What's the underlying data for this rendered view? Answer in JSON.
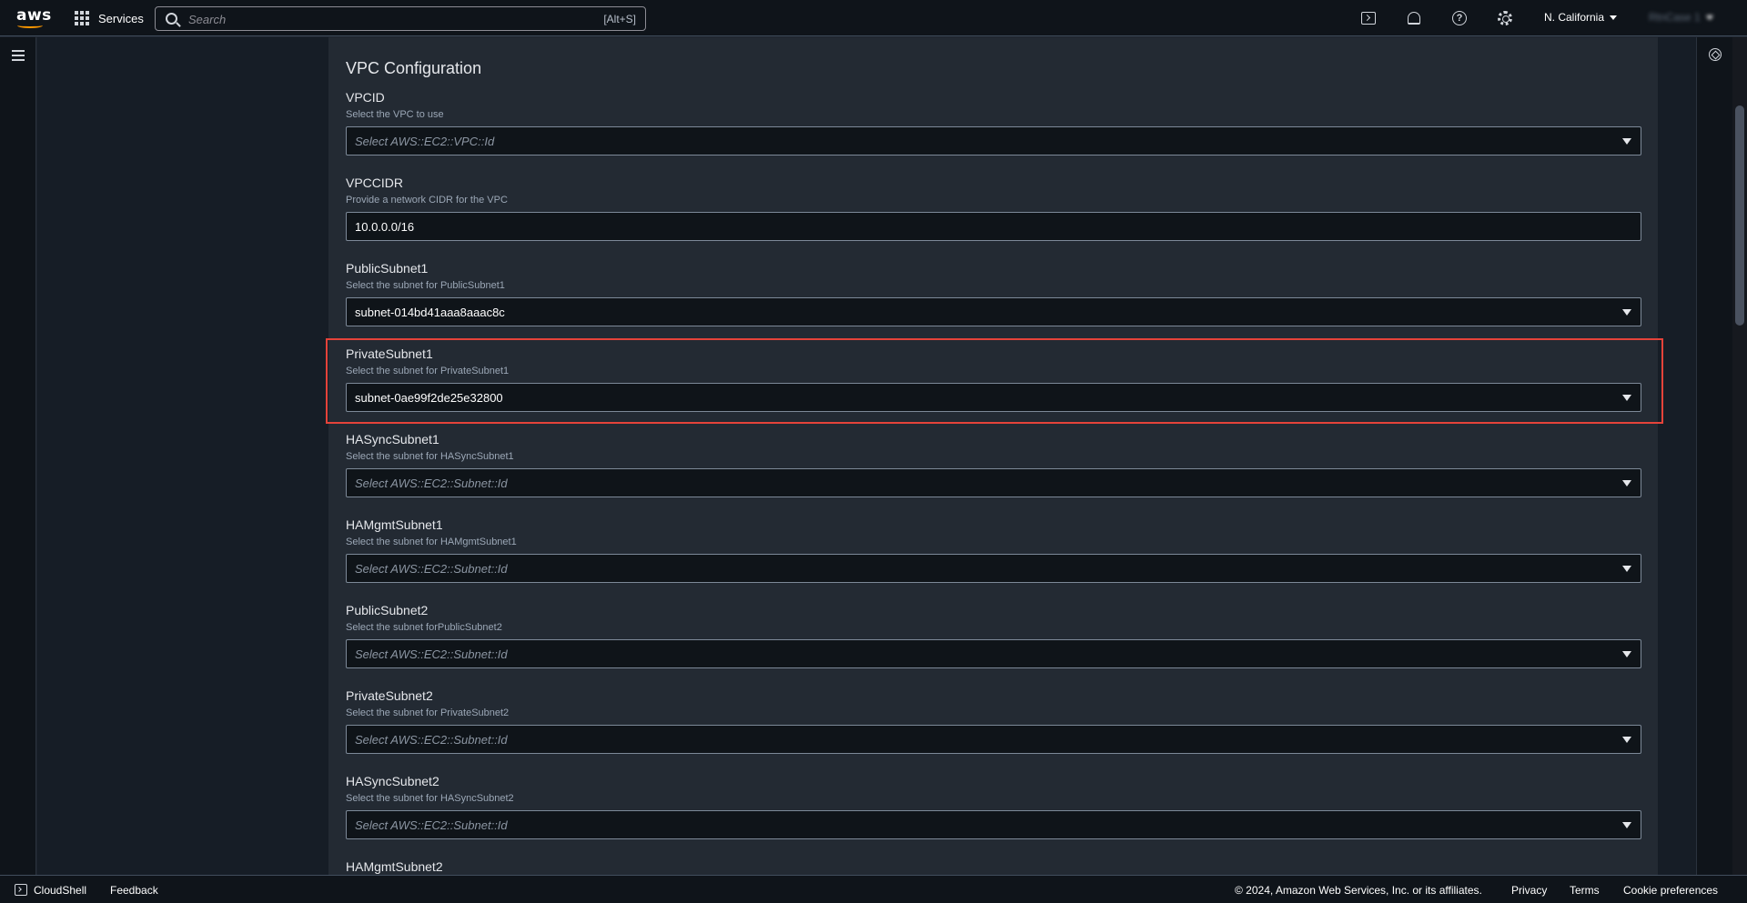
{
  "nav": {
    "logo": "aws",
    "services_label": "Services",
    "search_placeholder": "Search",
    "search_shortcut": "[Alt+S]",
    "region": "N. California",
    "account": "RtnCase 1"
  },
  "form": {
    "section_title": "VPC Configuration",
    "fields": [
      {
        "label": "VPCID",
        "description": "Select the VPC to use",
        "value": "Select AWS::EC2::VPC::Id",
        "type": "select",
        "is_placeholder": true
      },
      {
        "label": "VPCCIDR",
        "description": "Provide a network CIDR for the VPC",
        "value": "10.0.0.0/16",
        "type": "text",
        "is_placeholder": false
      },
      {
        "label": "PublicSubnet1",
        "description": "Select the subnet for PublicSubnet1",
        "value": "subnet-014bd41aaa8aaac8c",
        "type": "select",
        "is_placeholder": false
      },
      {
        "label": "PrivateSubnet1",
        "description": "Select the subnet for PrivateSubnet1",
        "value": "subnet-0ae99f2de25e32800",
        "type": "select",
        "is_placeholder": false
      },
      {
        "label": "HASyncSubnet1",
        "description": "Select the subnet for HASyncSubnet1",
        "value": "Select AWS::EC2::Subnet::Id",
        "type": "select",
        "is_placeholder": true
      },
      {
        "label": "HAMgmtSubnet1",
        "description": "Select the subnet for HAMgmtSubnet1",
        "value": "Select AWS::EC2::Subnet::Id",
        "type": "select",
        "is_placeholder": true
      },
      {
        "label": "PublicSubnet2",
        "description": "Select the subnet forPublicSubnet2",
        "value": "Select AWS::EC2::Subnet::Id",
        "type": "select",
        "is_placeholder": true
      },
      {
        "label": "PrivateSubnet2",
        "description": "Select the subnet for PrivateSubnet2",
        "value": "Select AWS::EC2::Subnet::Id",
        "type": "select",
        "is_placeholder": true
      },
      {
        "label": "HASyncSubnet2",
        "description": "Select the subnet for HASyncSubnet2",
        "value": "Select AWS::EC2::Subnet::Id",
        "type": "select",
        "is_placeholder": true
      },
      {
        "label": "HAMgmtSubnet2",
        "description": "",
        "value": "",
        "type": "select",
        "is_placeholder": true
      }
    ],
    "highlighted_field": "PrivateSubnet1"
  },
  "footer": {
    "cloudshell_label": "CloudShell",
    "feedback_label": "Feedback",
    "copyright": "© 2024, Amazon Web Services, Inc. or its affiliates.",
    "privacy": "Privacy",
    "terms": "Terms",
    "cookie": "Cookie preferences"
  },
  "colors": {
    "highlight": "#e5433a",
    "nav_bg": "#0f141a",
    "card_bg": "#232a33",
    "accent": "#ff9900"
  }
}
